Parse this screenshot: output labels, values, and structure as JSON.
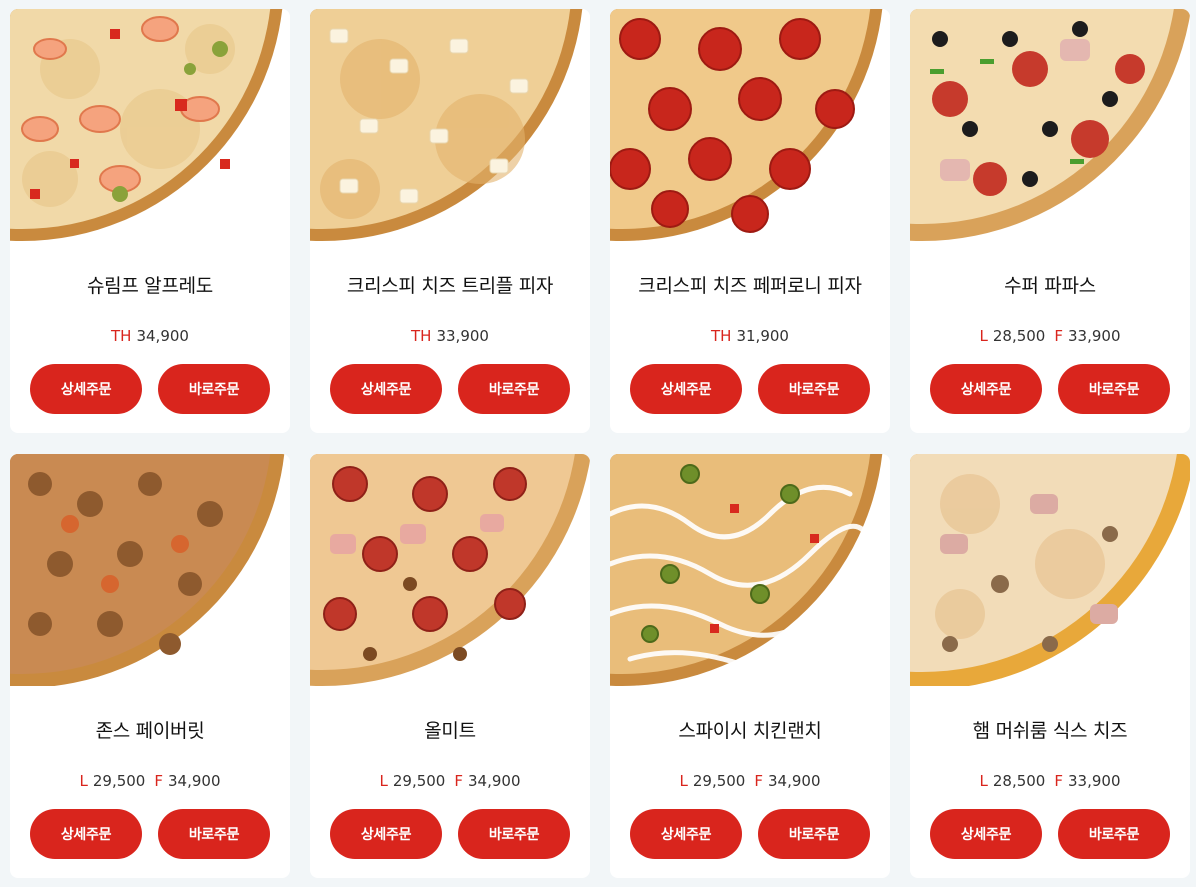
{
  "products": [
    {
      "name": "슈림프 알프레도",
      "prices": [
        {
          "size": "TH",
          "price": "34,900"
        }
      ],
      "detail_label": "상세주문",
      "order_label": "바로주문"
    },
    {
      "name": "크리스피 치즈 트리플 피자",
      "prices": [
        {
          "size": "TH",
          "price": "33,900"
        }
      ],
      "detail_label": "상세주문",
      "order_label": "바로주문"
    },
    {
      "name": "크리스피 치즈 페퍼로니 피자",
      "prices": [
        {
          "size": "TH",
          "price": "31,900"
        }
      ],
      "detail_label": "상세주문",
      "order_label": "바로주문"
    },
    {
      "name": "수퍼 파파스",
      "prices": [
        {
          "size": "L",
          "price": "28,500"
        },
        {
          "size": "F",
          "price": "33,900"
        }
      ],
      "detail_label": "상세주문",
      "order_label": "바로주문"
    },
    {
      "name": "존스 페이버릿",
      "prices": [
        {
          "size": "L",
          "price": "29,500"
        },
        {
          "size": "F",
          "price": "34,900"
        }
      ],
      "detail_label": "상세주문",
      "order_label": "바로주문"
    },
    {
      "name": "올미트",
      "prices": [
        {
          "size": "L",
          "price": "29,500"
        },
        {
          "size": "F",
          "price": "34,900"
        }
      ],
      "detail_label": "상세주문",
      "order_label": "바로주문"
    },
    {
      "name": "스파이시 치킨랜치",
      "prices": [
        {
          "size": "L",
          "price": "29,500"
        },
        {
          "size": "F",
          "price": "34,900"
        }
      ],
      "detail_label": "상세주문",
      "order_label": "바로주문"
    },
    {
      "name": "햄 머쉬룸 식스 치즈",
      "prices": [
        {
          "size": "L",
          "price": "28,500"
        },
        {
          "size": "F",
          "price": "33,900"
        }
      ],
      "detail_label": "상세주문",
      "order_label": "바로주문"
    }
  ],
  "colors": {
    "accent": "#d9251d",
    "page_bg": "#f2f6f8",
    "card_bg": "#ffffff"
  },
  "images": [
    "pizza-shrimp-alfredo-image",
    "pizza-crispy-cheese-triple-image",
    "pizza-crispy-cheese-pepperoni-image",
    "pizza-super-papas-image",
    "pizza-johns-favorite-image",
    "pizza-all-meat-image",
    "pizza-spicy-chicken-ranch-image",
    "pizza-ham-mushroom-six-cheese-image"
  ]
}
